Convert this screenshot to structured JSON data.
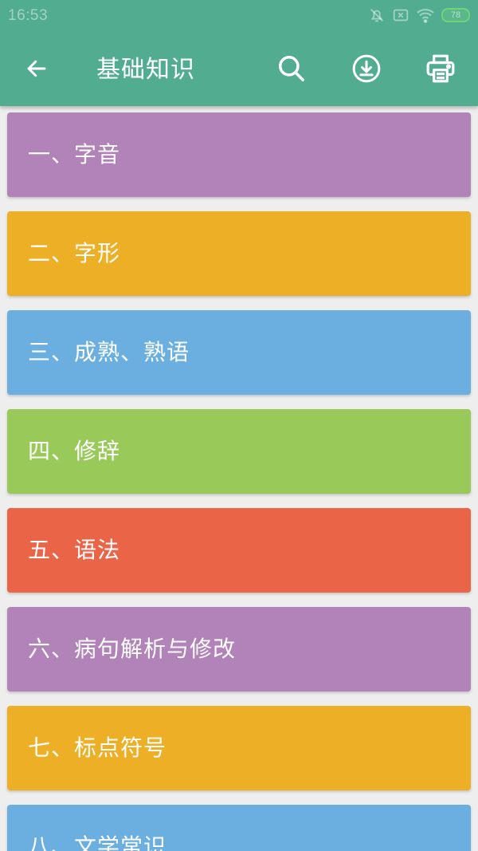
{
  "status_bar": {
    "time": "16:53",
    "battery": "78"
  },
  "toolbar": {
    "title": "基础知识",
    "icons": [
      "arrow-back-icon",
      "search-icon",
      "download-icon",
      "print-icon"
    ]
  },
  "colors": {
    "primary": "#52ad90",
    "purple": "#b283b8",
    "orange": "#edaf25",
    "blue": "#6aafe0",
    "green": "#98c959",
    "red": "#ea6548"
  },
  "items": [
    {
      "label": "一、字音",
      "color": "#b283b8"
    },
    {
      "label": "二、字形",
      "color": "#edaf25"
    },
    {
      "label": "三、成熟、熟语",
      "color": "#6aafe0"
    },
    {
      "label": "四、修辞",
      "color": "#98c959"
    },
    {
      "label": "五、语法",
      "color": "#ea6548"
    },
    {
      "label": "六、病句解析与修改",
      "color": "#b283b8"
    },
    {
      "label": "七、标点符号",
      "color": "#edaf25"
    },
    {
      "label": "八、文学常识",
      "color": "#6aafe0"
    }
  ]
}
